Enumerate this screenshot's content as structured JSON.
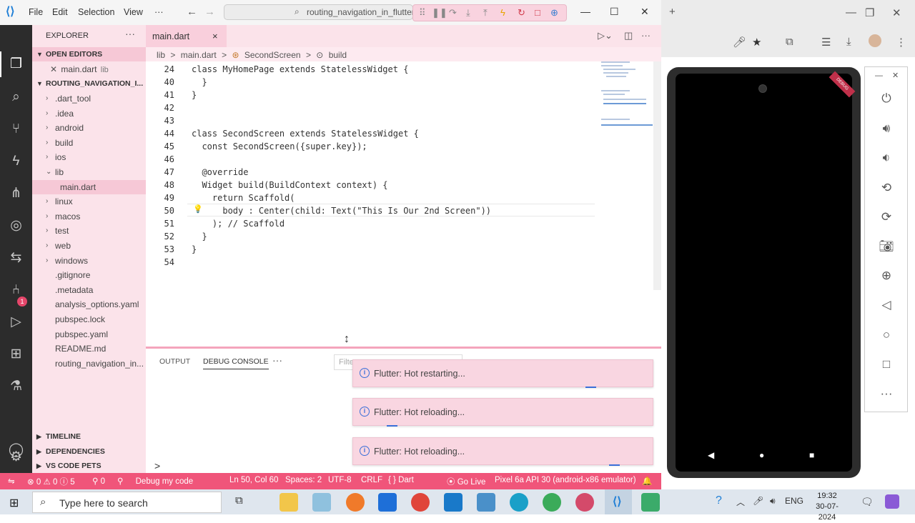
{
  "titlebar": {
    "menus": [
      "File",
      "Edit",
      "Selection",
      "View",
      "···"
    ],
    "search_text": "routing_navigation_in_flutter",
    "window_controls": [
      "minimize-icon",
      "maximize-icon",
      "close-icon"
    ]
  },
  "sidebar": {
    "title": "EXPLORER",
    "more": "···",
    "open_editors_header": "OPEN EDITORS",
    "open_editor_file": "main.dart",
    "open_editor_folder": "lib",
    "project_header": "ROUTING_NAVIGATION_I...",
    "tree": [
      {
        "label": ".dart_tool",
        "folder": true
      },
      {
        "label": ".idea",
        "folder": true
      },
      {
        "label": "android",
        "folder": true
      },
      {
        "label": "build",
        "folder": true
      },
      {
        "label": "ios",
        "folder": true
      },
      {
        "label": "lib",
        "folder": true,
        "open": true
      },
      {
        "label": "main.dart",
        "folder": false,
        "selected": true
      },
      {
        "label": "linux",
        "folder": true
      },
      {
        "label": "macos",
        "folder": true
      },
      {
        "label": "test",
        "folder": true
      },
      {
        "label": "web",
        "folder": true
      },
      {
        "label": "windows",
        "folder": true
      },
      {
        "label": ".gitignore",
        "folder": false
      },
      {
        "label": ".metadata",
        "folder": false
      },
      {
        "label": "analysis_options.yaml",
        "folder": false
      },
      {
        "label": "pubspec.lock",
        "folder": false
      },
      {
        "label": "pubspec.yaml",
        "folder": false
      },
      {
        "label": "README.md",
        "folder": false
      },
      {
        "label": "routing_navigation_in...",
        "folder": false
      }
    ],
    "timeline": "TIMELINE",
    "dependencies": "DEPENDENCIES",
    "code_pets": "VS CODE PETS"
  },
  "editor": {
    "tab_label": "main.dart",
    "tab_close": "×",
    "breadcrumb": [
      "lib",
      ">",
      "main.dart",
      ">",
      "SecondScreen",
      ">",
      "build"
    ],
    "lines": [
      {
        "n": "24",
        "text": "class MyHomePage extends StatelessWidget {"
      },
      {
        "n": "40",
        "text": "  }"
      },
      {
        "n": "41",
        "text": "}"
      },
      {
        "n": "42",
        "text": ""
      },
      {
        "n": "43",
        "text": ""
      },
      {
        "n": "44",
        "text": "class SecondScreen extends StatelessWidget {"
      },
      {
        "n": "45",
        "text": "  const SecondScreen({super.key});"
      },
      {
        "n": "46",
        "text": ""
      },
      {
        "n": "47",
        "text": "  @override"
      },
      {
        "n": "48",
        "text": "  Widget build(BuildContext context) {"
      },
      {
        "n": "49",
        "text": "    return Scaffold("
      },
      {
        "n": "50",
        "text": "      body : Center(child: Text(\"This Is Our 2nd Screen\"))"
      },
      {
        "n": "51",
        "text": "    ); // Scaffold"
      },
      {
        "n": "52",
        "text": "  }"
      },
      {
        "n": "53",
        "text": "}"
      },
      {
        "n": "54",
        "text": ""
      }
    ]
  },
  "panel": {
    "tabs": [
      "OUTPUT",
      "DEBUG CONSOLE",
      "···"
    ],
    "filter_placeholder": "Filter",
    "prompt": ">"
  },
  "toasts": [
    "Flutter: Hot restarting...",
    "Flutter: Hot reloading...",
    "Flutter: Hot reloading..."
  ],
  "statusbar": {
    "errors": "0",
    "warnings": "0",
    "infos": "5",
    "ports": "0",
    "debug": "Debug my code",
    "position": "Ln 50, Col 60",
    "spaces": "Spaces: 2",
    "encoding": "UTF-8",
    "eol": "CRLF",
    "language": "Dart",
    "golive": "Go Live",
    "device": "Pixel 6a API 30 (android-x86 emulator)"
  },
  "taskbar": {
    "search_placeholder": "Type here to search",
    "lang": "ENG",
    "time": "19:32",
    "date": "30-07-2024"
  },
  "emulator": {
    "ribbon": "DEBUG"
  },
  "colors": {
    "accent_pink": "#f0557a",
    "sidebar_bg": "#fbe3ea",
    "activity_bg": "#2c2c2c"
  }
}
